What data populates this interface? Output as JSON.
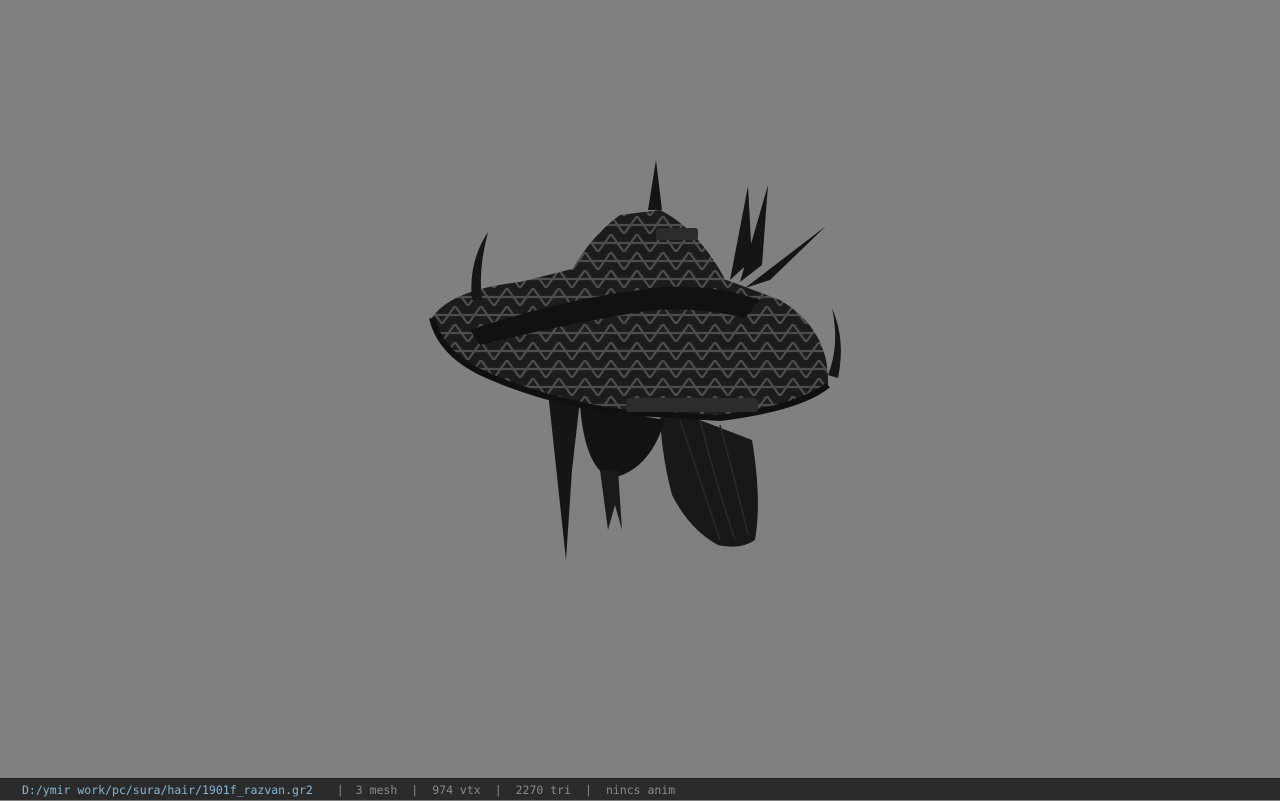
{
  "viewport": {
    "background_color": "#808080",
    "model_color": "#1a1a1a",
    "model_highlight": "#4a4a4a",
    "model_description_icon": "hat-hair-model"
  },
  "statusbar": {
    "file_path": "D:/ymir work/pc/sura/hair/1901f_razvan.gr2",
    "mesh_count": "3 mesh",
    "vertex_count": "974 vtx",
    "triangle_count": "2270 tri",
    "anim_status": "nincs anim",
    "separator": "|",
    "path_color": "#7fb8d8",
    "text_color": "#8a8a8a"
  }
}
